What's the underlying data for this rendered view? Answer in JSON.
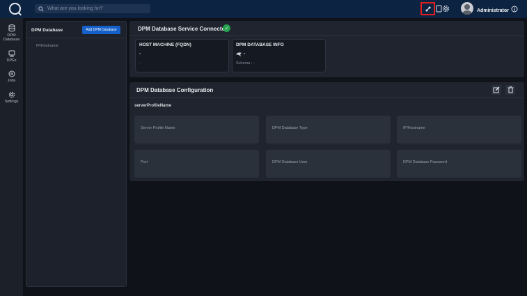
{
  "topbar": {
    "search_placeholder": "What are you looking for?",
    "username": "Administrator"
  },
  "nav": {
    "items": [
      {
        "label": "DPM Database",
        "icon": "database-icon"
      },
      {
        "label": "DPEs",
        "icon": "server-icon"
      },
      {
        "label": "Jobs",
        "icon": "jobs-icon"
      },
      {
        "label": "Settings",
        "icon": "gear-icon"
      }
    ]
  },
  "list_panel": {
    "title": "DPM Database",
    "add_button": "Add DPM Database",
    "column": "IP/Hostname"
  },
  "service": {
    "title": "DPM Database Service Connected",
    "host_card": {
      "title": "HOST MACHINE (FQDN)",
      "value": "-",
      "sub": "-"
    },
    "info_card": {
      "title": "DPM DATABASE INFO",
      "value": "-",
      "sub": "Schema : -"
    }
  },
  "config": {
    "title": "DPM Database Configuration",
    "subtitle": "serverProfileName",
    "fields": [
      "Server Profile Name",
      "DPM Database Type",
      "IP/Hostname",
      "Port",
      "DPM Database User",
      "DPM Database Password"
    ]
  },
  "colors": {
    "topbar": "#0c2341",
    "accent": "#1560c9",
    "success": "#25a14f",
    "highlight": "#e0201c"
  }
}
